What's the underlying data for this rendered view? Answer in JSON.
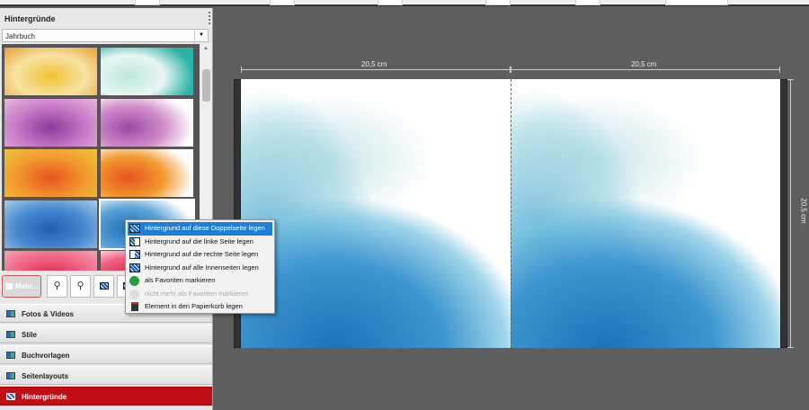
{
  "panel": {
    "title": "Hintergründe",
    "category_select": "Jahrbuch",
    "more_button": "Mehr..."
  },
  "thumbnails": [
    {
      "colors": [
        "#f1c232",
        "#f6e3a3",
        "#e9a53a"
      ],
      "selected": false
    },
    {
      "colors": [
        "#bfe7e2",
        "#e9f6f2",
        "#2bb3a7"
      ],
      "selected": false
    },
    {
      "colors": [
        "#8a3a9a",
        "#c77bc8",
        "#e8b3d9"
      ],
      "selected": false
    },
    {
      "colors": [
        "#9a4aa6",
        "#d18cc9",
        "#ffffff"
      ],
      "selected": false
    },
    {
      "colors": [
        "#e7531f",
        "#f29a2f",
        "#f0c23a"
      ],
      "selected": false
    },
    {
      "colors": [
        "#e7531f",
        "#f29a2f",
        "#ffffff"
      ],
      "selected": false
    },
    {
      "colors": [
        "#1f5fb0",
        "#4a8ad0",
        "#9fc8e8"
      ],
      "selected": false
    },
    {
      "colors": [
        "#1f6fb8",
        "#59a3d8",
        "#ffffff"
      ],
      "selected": true
    },
    {
      "colors": [
        "#d8203a",
        "#f06080",
        "#f3a0b0"
      ],
      "selected": false
    },
    {
      "colors": [
        "#d8203a",
        "#f06080",
        "#ffffff"
      ],
      "selected": false
    }
  ],
  "nav": [
    {
      "label": "Fotos & Videos",
      "active": false
    },
    {
      "label": "Stile",
      "active": false
    },
    {
      "label": "Buchvorlagen",
      "active": false
    },
    {
      "label": "Seitenlayouts",
      "active": false
    },
    {
      "label": "Hintergründe",
      "active": true
    }
  ],
  "canvas": {
    "width_left": "20,5 cm",
    "width_right": "20,5 cm",
    "height": "20,5 cm"
  },
  "context_menu": [
    {
      "label": "Hintergrund auf diese Doppelseite legen",
      "icon": "spread-background-icon",
      "highlighted": true,
      "disabled": false
    },
    {
      "label": "Hintergrund auf die linke Seite legen",
      "icon": "left-page-background-icon",
      "highlighted": false,
      "disabled": false
    },
    {
      "label": "Hintergrund auf die rechte Seite legen",
      "icon": "right-page-background-icon",
      "highlighted": false,
      "disabled": false
    },
    {
      "label": "Hintergrund auf alle Innenseiten legen",
      "icon": "all-pages-background-icon",
      "highlighted": false,
      "disabled": false
    },
    {
      "label": "als Favoriten markieren",
      "icon": "favorite-icon",
      "highlighted": false,
      "disabled": false
    },
    {
      "label": "nicht mehr als Favoriten markieren",
      "icon": "unfavorite-icon",
      "highlighted": false,
      "disabled": true
    },
    {
      "label": "Element in den Papierkorb legen",
      "icon": "trash-icon",
      "highlighted": false,
      "disabled": false
    }
  ],
  "colors": {
    "accent": "#c10d16",
    "highlight": "#1f7fd6",
    "canvas": "#5e5e5e"
  }
}
